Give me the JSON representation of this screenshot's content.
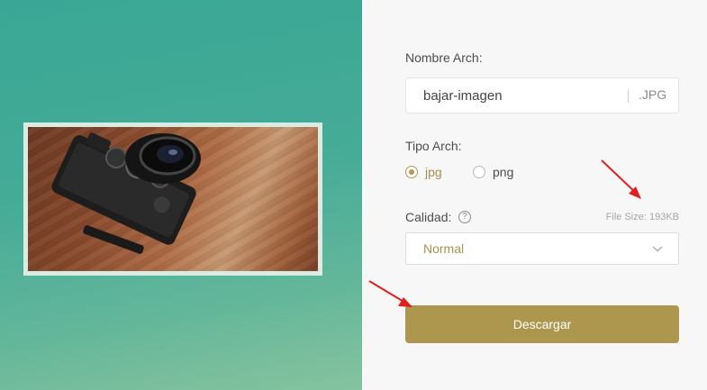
{
  "form": {
    "name_label": "Nombre Arch:",
    "name_value": "bajar-imagen",
    "extension": ".JPG",
    "type_label": "Tipo Arch:",
    "type_options": [
      {
        "label": "jpg",
        "checked": true
      },
      {
        "label": "png",
        "checked": false
      }
    ],
    "quality_label": "Calidad:",
    "help_icon_glyph": "?",
    "file_size": "File Size: 193KB",
    "quality_value": "Normal",
    "download_label": "Descargar"
  },
  "icons": {
    "help": "question-circle-icon",
    "chevron": "chevron-down-icon",
    "annotation": "red-arrow-icon"
  },
  "colors": {
    "accent": "#ad974e",
    "accent_text": "#a8914c",
    "arrow": "#e02020",
    "left_bg_top": "#3aa796",
    "left_bg_bottom": "#86c39e"
  }
}
